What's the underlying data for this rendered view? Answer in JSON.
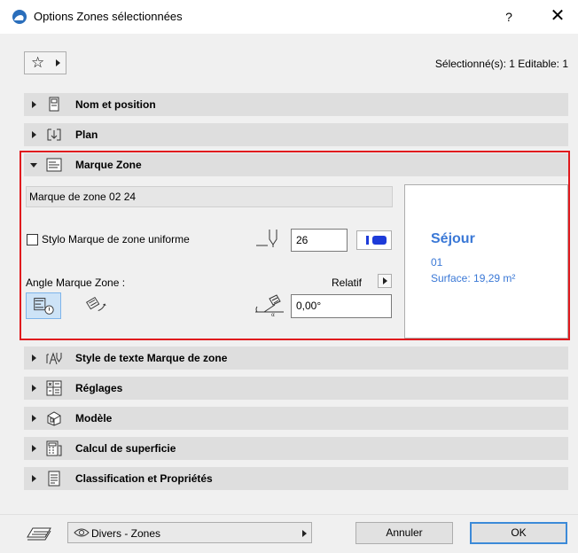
{
  "window": {
    "title": "Options Zones sélectionnées",
    "help": "?",
    "close": "✕"
  },
  "toolbar": {
    "selection_info": "Sélectionné(s): 1 Editable: 1"
  },
  "panels": [
    {
      "label": "Nom et position",
      "icon": "name-position-icon",
      "expanded": false
    },
    {
      "label": "Plan",
      "icon": "plan-icon",
      "expanded": false
    },
    {
      "label": "Marque Zone",
      "icon": "zone-stamp-icon",
      "expanded": true
    },
    {
      "label": "Style de texte Marque de zone",
      "icon": "text-style-icon",
      "expanded": false
    },
    {
      "label": "Réglages",
      "icon": "settings-grid-icon",
      "expanded": false
    },
    {
      "label": "Modèle",
      "icon": "model-icon",
      "expanded": false
    },
    {
      "label": "Calcul de superficie",
      "icon": "area-calc-icon",
      "expanded": false
    },
    {
      "label": "Classification et Propriétés",
      "icon": "classification-icon",
      "expanded": false
    }
  ],
  "marque_zone": {
    "stamp_name": "Marque de zone 02 24",
    "uniform_pen_label": "Stylo Marque de zone uniforme",
    "uniform_pen_checked": false,
    "pen_value": "26",
    "pen_color": "#1d3bd9",
    "angle_label": "Angle Marque Zone :",
    "relatif_label": "Relatif",
    "angle_value": "0,00°",
    "preview": {
      "zone_name": "Séjour",
      "zone_number": "01",
      "surface": "Surface: 19,29 m²",
      "text_color": "#3a78d6"
    }
  },
  "footer": {
    "layer": "Divers - Zones",
    "cancel": "Annuler",
    "ok": "OK"
  },
  "colors": {
    "highlight_frame": "#e0191d",
    "ok_border": "#3c8ad8",
    "active_toggle": "#cde3f7"
  }
}
